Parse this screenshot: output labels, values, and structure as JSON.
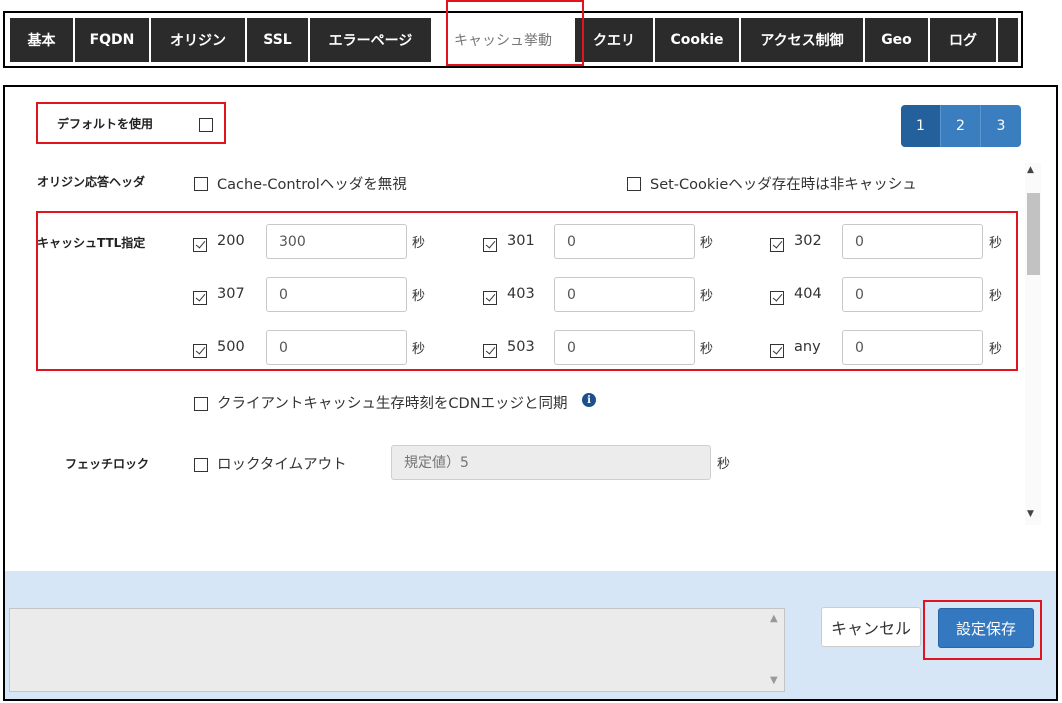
{
  "tabs": [
    {
      "label": "基本",
      "active": false
    },
    {
      "label": "FQDN",
      "active": false
    },
    {
      "label": "オリジン",
      "active": false
    },
    {
      "label": "SSL",
      "active": false
    },
    {
      "label": "エラーページ",
      "active": false
    },
    {
      "label": "キャッシュ挙動",
      "active": true
    },
    {
      "label": "クエリ",
      "active": false
    },
    {
      "label": "Cookie",
      "active": false
    },
    {
      "label": "アクセス制御",
      "active": false
    },
    {
      "label": "Geo",
      "active": false
    },
    {
      "label": "ログ",
      "active": false
    }
  ],
  "use_default": {
    "label": "デフォルトを使用",
    "checked": false
  },
  "pagination": [
    {
      "label": "1",
      "active": true
    },
    {
      "label": "2",
      "active": false
    },
    {
      "label": "3",
      "active": false
    }
  ],
  "origin_headers": {
    "label": "オリジン応答ヘッダ",
    "ignore_cache_control": {
      "label": "Cache-Controlヘッダを無視",
      "checked": false
    },
    "no_cache_set_cookie": {
      "label": "Set-Cookieヘッダ存在時は非キャッシュ",
      "checked": false
    }
  },
  "cache_ttl": {
    "label": "キャッシュTTL指定",
    "unit": "秒",
    "rows": [
      [
        {
          "code": "200",
          "checked": true,
          "value": "300"
        },
        {
          "code": "301",
          "checked": true,
          "value": "0"
        },
        {
          "code": "302",
          "checked": true,
          "value": "0"
        }
      ],
      [
        {
          "code": "307",
          "checked": true,
          "value": "0"
        },
        {
          "code": "403",
          "checked": true,
          "value": "0"
        },
        {
          "code": "404",
          "checked": true,
          "value": "0"
        }
      ],
      [
        {
          "code": "500",
          "checked": true,
          "value": "0"
        },
        {
          "code": "503",
          "checked": true,
          "value": "0"
        },
        {
          "code": "any",
          "checked": true,
          "value": "0"
        }
      ]
    ]
  },
  "client_cache_sync": {
    "label": "クライアントキャッシュ生存時刻をCDNエッジと同期",
    "checked": false,
    "info_icon": "i"
  },
  "fetch_lock": {
    "label": "フェッチロック",
    "lock_timeout": {
      "label": "ロックタイムアウト",
      "checked": false
    },
    "placeholder": "規定値）5",
    "unit": "秒"
  },
  "actions": {
    "cancel": "キャンセル",
    "save": "設定保存"
  },
  "colors": {
    "highlight": "#e0141e",
    "primary": "#3478bf",
    "tab_dark": "#2b2b2b",
    "band": "#d6e6f7"
  }
}
